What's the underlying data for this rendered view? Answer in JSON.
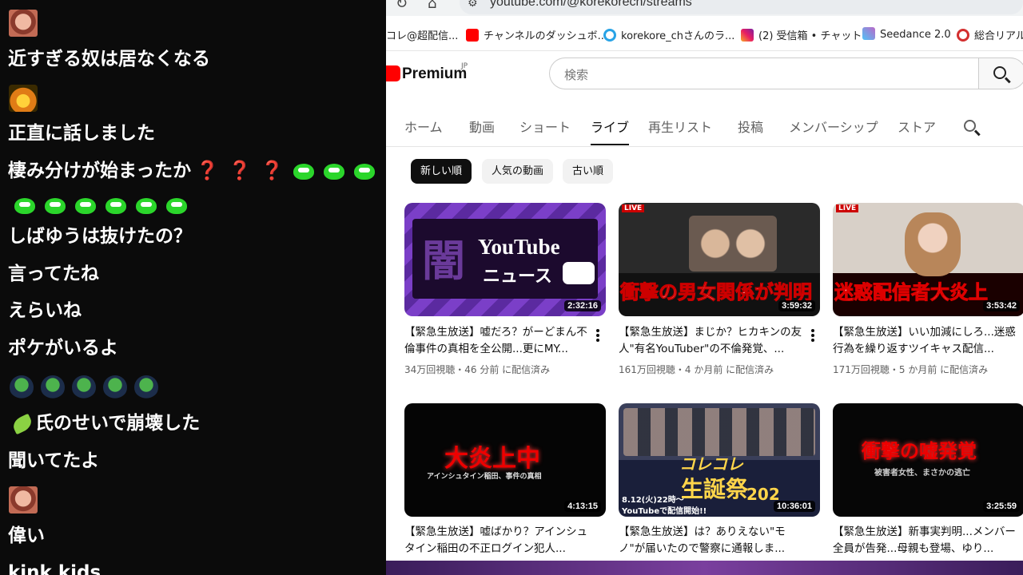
{
  "chat": {
    "messages": [
      "近すぎる奴は居なくなる",
      "正直に話しました",
      "棲み分けが始まったか",
      "しばゆうは抜けたの？",
      "言ってたね",
      "えらいね",
      "ポケがいるよ",
      "氏のせいで崩壊した",
      "聞いてたよ",
      "偉い",
      "kink kids"
    ],
    "question_mark": "❓",
    "accent_color": "#e8264a",
    "emote_color": "#2bd62b"
  },
  "browser": {
    "url": "youtube.com/@korekorech/streams",
    "bookmarks": [
      "コレ@超配信...",
      "チャンネルのダッシュボ...",
      "korekore_chさんのラ...",
      "(2) 受信箱 • チャット",
      "Seedance 2.0",
      "総合リアル"
    ],
    "brand": "Premium",
    "brand_region": "JP",
    "search_placeholder": "検索",
    "tabs": [
      "ホーム",
      "動画",
      "ショート",
      "ライブ",
      "再生リスト",
      "投稿",
      "メンバーシップ",
      "ストア"
    ],
    "active_tab": "ライブ",
    "chips": [
      "新しい順",
      "人気の動画",
      "古い順"
    ],
    "active_chip": "新しい順",
    "videos": [
      {
        "title": "【緊急生放送】嘘だろ？がーどまん不倫事件の真相を全公開...更にMY...",
        "meta": "34万回視聴・46 分前 に配信済み",
        "duration": "2:32:16",
        "thumb_text": [
          "闇",
          "YouTube",
          "ニュース"
        ]
      },
      {
        "title": "【緊急生放送】まじか？ヒカキンの友人\"有名YouTuber\"の不倫発覚、...",
        "meta": "161万回視聴・4 か月前 に配信済み",
        "duration": "3:59:32",
        "thumb_text": [
          "LIVE",
          "衝撃の男女関係が判明"
        ]
      },
      {
        "title": "【緊急生放送】いい加減にしろ...迷惑行為を繰り返すツイキャス配信...",
        "meta": "171万回視聴・5 か月前 に配信済み",
        "duration": "3:53:42",
        "thumb_text": [
          "LIVE",
          "迷惑配信者大炎上"
        ]
      },
      {
        "title": "【緊急生放送】嘘ばかり？アインシュタイン稲田の不正ログイン犯人...",
        "meta": "",
        "duration": "4:13:15",
        "thumb_text": [
          "大炎上中",
          "アインシュタイン稲田、事件の真相"
        ]
      },
      {
        "title": "【緊急生放送】は？ありえない\"モノ\"が届いたので警察に通報しま...",
        "meta": "",
        "duration": "10:36:01",
        "thumb_text": [
          "コレコレ",
          "生誕祭",
          "202",
          "8.12(火)22時〜",
          "YouTubeで配信開始!!"
        ]
      },
      {
        "title": "【緊急生放送】新事実判明...メンバー全員が告発...母親も登場、ゆり...",
        "meta": "",
        "duration": "3:25:59",
        "thumb_text": [
          "衝撃の嘘発覚",
          "被害者女性、まさかの逃亡"
        ]
      }
    ]
  }
}
